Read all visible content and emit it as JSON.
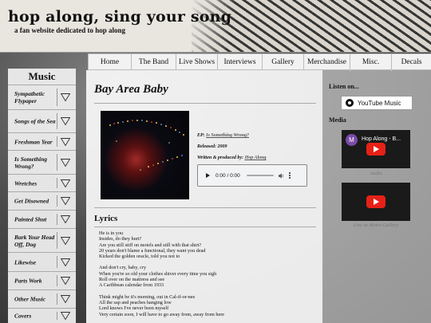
{
  "header": {
    "title": "hop along, sing your song",
    "subtitle": "a fan website dedicated to hop along"
  },
  "nav": {
    "items": [
      {
        "label": "Home"
      },
      {
        "label": "The Band"
      },
      {
        "label": "Live Shows"
      },
      {
        "label": "Interviews"
      },
      {
        "label": "Gallery"
      },
      {
        "label": "Merchandise"
      },
      {
        "label": "Misc."
      },
      {
        "label": "Decals"
      }
    ]
  },
  "sidebar": {
    "heading": "Music",
    "items": [
      {
        "label": "Sympathetic Flypaper"
      },
      {
        "label": "Songs of the Sea"
      },
      {
        "label": "Freshman Year"
      },
      {
        "label": "Is Something Wrong?"
      },
      {
        "label": "Wretches"
      },
      {
        "label": "Get Disowned"
      },
      {
        "label": "Painted Shut"
      },
      {
        "label": "Bark Your Head Off, Dog"
      },
      {
        "label": "Likewise"
      },
      {
        "label": "Parts Work"
      },
      {
        "label": "Other Music"
      },
      {
        "label": "Covers"
      }
    ]
  },
  "song": {
    "title": "Bay Area Baby",
    "ep_label": "EP:",
    "ep_value": "Is Something Wrong?",
    "released_label": "Released:",
    "released_value": "2009",
    "credits_label": "Written & produced by:",
    "credits_value": "Hop Along"
  },
  "audio_player": {
    "time": "0:00 / 0:00",
    "progress": 0
  },
  "lyrics": {
    "heading": "Lyrics",
    "stanzas": [
      [
        "He is in you",
        "Insides, do they hurt?",
        "Are you still stiff on motels and still with that shirt?",
        "20 years don't blame a functional, they want you dead",
        "Kicked the golden oracle, told you not to"
      ],
      [
        "And don't cry, baby, cry",
        "When you're so old your clothes shiver every time you sigh",
        "Roll over on the mattress and see",
        "A Caribbean calendar from 1933"
      ],
      [
        "Think might be it's morning, out in Cal-if-or-nee",
        "All the sap and peaches hanging low",
        "Lord knows I've never been myself",
        "Very certain soon, I will have to go away from, away from here"
      ]
    ]
  },
  "right_panel": {
    "listen_heading": "Listen on...",
    "youtube_music_label": "YouTube Music",
    "media_heading": "Media",
    "videos": [
      {
        "title": "Hop Along - B...",
        "avatar_letter": "M",
        "caption": "Audio"
      },
      {
        "title": "",
        "avatar_letter": "",
        "caption": "Live at Metro Gallery"
      }
    ]
  },
  "colors": {
    "youtube_red": "#e62117",
    "cover_red": "#a02a2a",
    "link_gray": "#555555"
  }
}
